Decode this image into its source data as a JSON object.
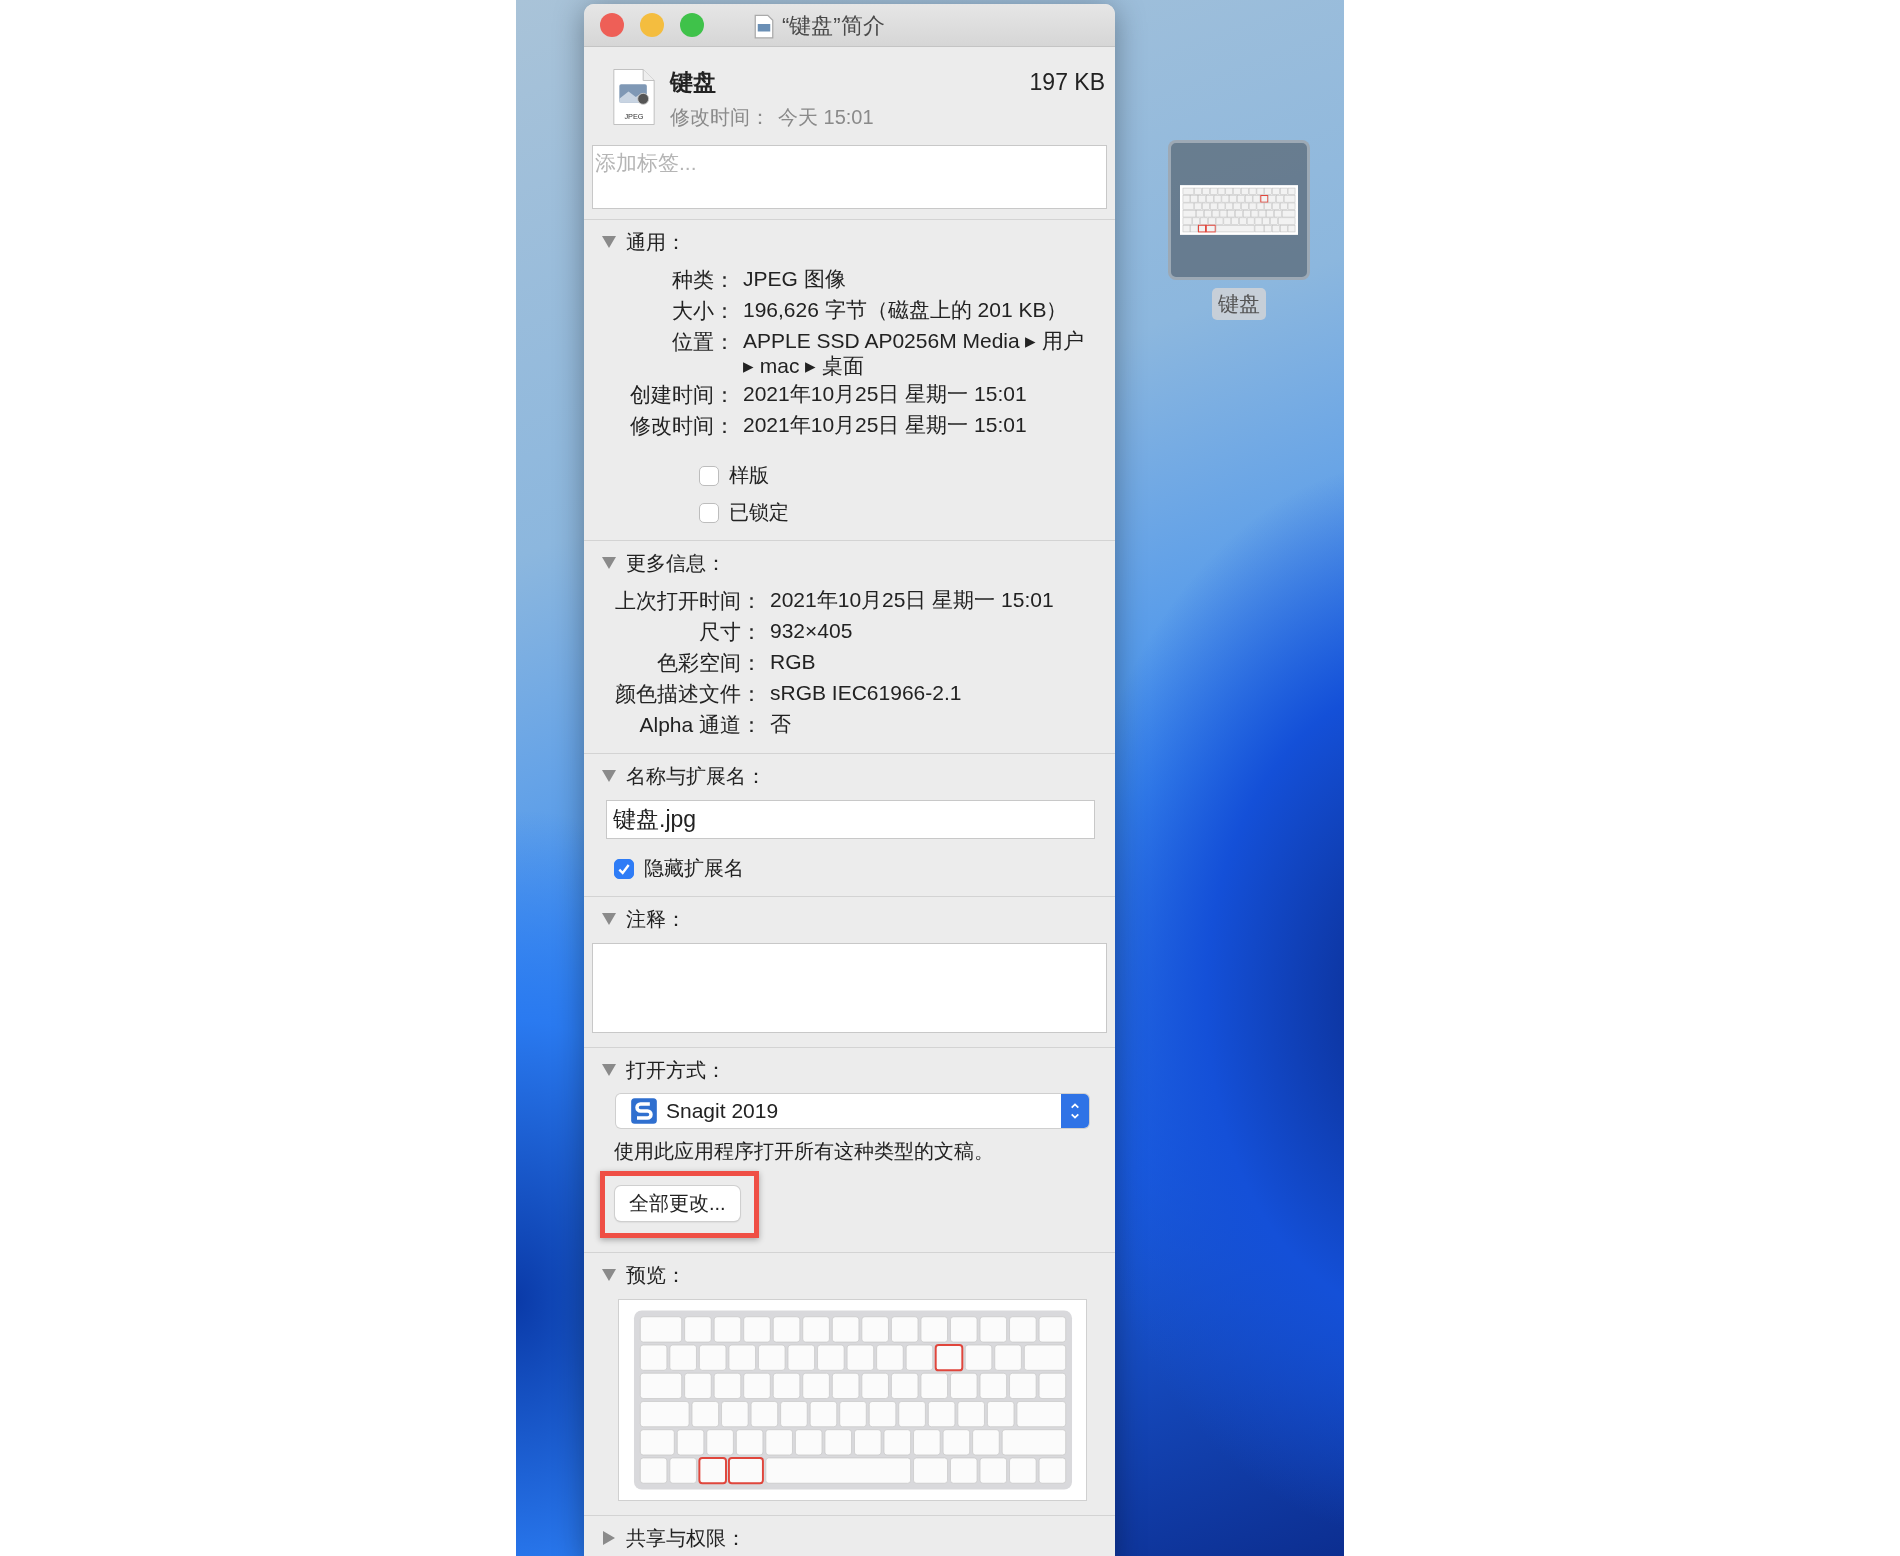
{
  "window": {
    "title": "“键盘”简介"
  },
  "file": {
    "name": "键盘",
    "size": "197 KB",
    "icon_label": "JPEG",
    "modified_label": "修改时间：",
    "modified_value": "今天 15:01"
  },
  "tags_field": {
    "placeholder": "添加标签..."
  },
  "sections": [
    {
      "kind": "info",
      "title": "通用：",
      "expanded": true,
      "rows": [
        {
          "label": "种类：",
          "value": "JPEG 图像"
        },
        {
          "label": "大小：",
          "value": "196,626 字节（磁盘上的 201 KB）"
        },
        {
          "label": "位置：",
          "value": "APPLE SSD AP0256M Media ▸ 用户 ▸ mac ▸ 桌面"
        },
        {
          "label": "创建时间：",
          "value": "2021年10月25日 星期一 15:01"
        },
        {
          "label": "修改时间：",
          "value": "2021年10月25日 星期一 15:01"
        }
      ],
      "checkboxes": [
        {
          "label": "样版",
          "checked": false
        },
        {
          "label": "已锁定",
          "checked": false
        }
      ]
    },
    {
      "kind": "info",
      "title": "更多信息：",
      "expanded": true,
      "rows": [
        {
          "label": "上次打开时间：",
          "value": "2021年10月25日 星期一 15:01"
        },
        {
          "label": "尺寸：",
          "value": "932×405"
        },
        {
          "label": "色彩空间：",
          "value": "RGB"
        },
        {
          "label": "颜色描述文件：",
          "value": "sRGB IEC61966-2.1"
        },
        {
          "label": "Alpha 通道：",
          "value": "否"
        }
      ]
    },
    {
      "kind": "name",
      "title": "名称与扩展名：",
      "expanded": true,
      "value": "键盘.jpg",
      "checkboxes": [
        {
          "label": "隐藏扩展名",
          "checked": true
        }
      ]
    },
    {
      "kind": "comments",
      "title": "注释：",
      "expanded": true
    },
    {
      "kind": "open_with",
      "title": "打开方式：",
      "expanded": true,
      "app": "Snagit 2019",
      "hint": "使用此应用程序打开所有这种类型的文稿。",
      "button": "全部更改...",
      "highlighted": true
    },
    {
      "kind": "preview",
      "title": "预览：",
      "expanded": true
    },
    {
      "title": "共享与权限：",
      "expanded": false
    }
  ],
  "desktop_icon": {
    "label": "键盘",
    "selected": true
  }
}
